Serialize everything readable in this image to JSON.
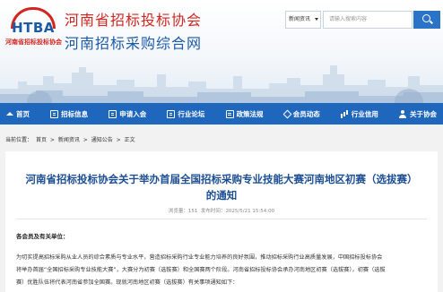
{
  "header": {
    "logo": {
      "mark": "HTBA",
      "subtitle": "河南省招标投标协会"
    },
    "title_line1": "河南省招标投标协会",
    "title_line2": "河南招标采购综合网"
  },
  "search": {
    "category_value": "新闻资讯",
    "placeholder": "请输入搜索内容"
  },
  "nav": {
    "items": [
      {
        "label": "首页",
        "icon": "home-icon"
      },
      {
        "label": "招标信息",
        "icon": "document-icon"
      },
      {
        "label": "申请入会",
        "icon": "document-icon"
      },
      {
        "label": "行业论坛",
        "icon": "document-icon"
      },
      {
        "label": "政策法规",
        "icon": "document-icon"
      },
      {
        "label": "会员动态",
        "icon": "diamond-icon"
      },
      {
        "label": "行业信用",
        "icon": "bar-chart-icon"
      },
      {
        "label": "关于协会",
        "icon": "person-icon"
      }
    ]
  },
  "breadcrumb": {
    "prefix": "当前位置：",
    "items": [
      "首页",
      "新闻资讯",
      "通知公告",
      "正文"
    ],
    "separator": ">"
  },
  "article": {
    "title_line1": "河南省招标投标协会关于举办首届全国招标采购专业技能大赛河南地区初赛（选拔赛）",
    "title_line2": "的通知",
    "meta_views_label": "浏览量：",
    "meta_views": "151",
    "meta_time_label": "发布时间：",
    "meta_time": "2025/5/21 15:54:00",
    "greeting": "各会员及有关单位：",
    "paragraph_lines": [
      "为切实提高招标采购从业人员的综合素质与专业水平，营造招标采购行业专业能力培养的良好氛围，推动招标采购行业高质量发展，中国招标投标协会",
      "将举办首届“全国招标采购专业技能大赛”，大赛分为初赛（选拔赛）和全国赛两个阶段。河南省招标投标协会承办河南地区初赛（选拔赛），初赛（选拔",
      "赛）优胜队伍将代表河南省参加全国赛。现就河南地区初赛（选拔赛）有关事项通知如下："
    ]
  },
  "colors": {
    "brand_blue": "#1f66bd",
    "brand_red": "#d1261f",
    "title_blue": "#1c4e93"
  }
}
